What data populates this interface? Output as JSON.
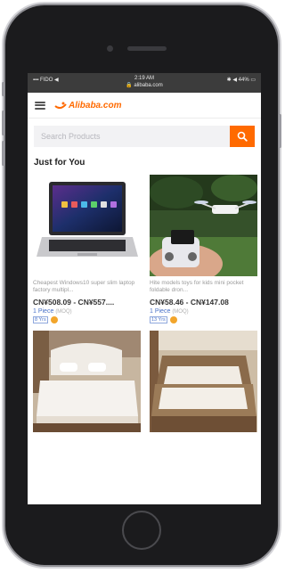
{
  "status_bar": {
    "carrier": "▪▪▪ FIDO ◀",
    "time": "2:19 AM",
    "url": "🔒 alibaba.com",
    "battery": "✱ ◀ 44% ▭"
  },
  "header": {
    "logo_text": "Alibaba.com",
    "menu_icon": "hamburger-icon"
  },
  "search": {
    "placeholder": "Search Products",
    "button_icon": "search-icon"
  },
  "section": {
    "title": "Just for You"
  },
  "products": [
    {
      "image_icon": "laptop-image",
      "description": "Cheapest Windows10 super slim laptop factory multipl...",
      "price": "CN¥508.09 - CN¥557....",
      "moq": "1 Piece",
      "moq_note": "(MOQ)",
      "badge": "8 Yrs"
    },
    {
      "image_icon": "drone-image",
      "description": "Hite models toys for kids mini pocket foldable dron...",
      "price": "CN¥58.46 - CN¥147.08",
      "moq": "1 Piece",
      "moq_note": "(MOQ)",
      "badge": "13 Yrs"
    },
    {
      "image_icon": "bed-image",
      "description": "",
      "price": "",
      "moq": "",
      "moq_note": "",
      "badge": ""
    },
    {
      "image_icon": "sofa-bed-image",
      "description": "",
      "price": "",
      "moq": "",
      "moq_note": "",
      "badge": ""
    }
  ],
  "colors": {
    "accent": "#ff6a00",
    "moq_blue": "#4a72c8",
    "gold_badge": "#f2a52b"
  }
}
